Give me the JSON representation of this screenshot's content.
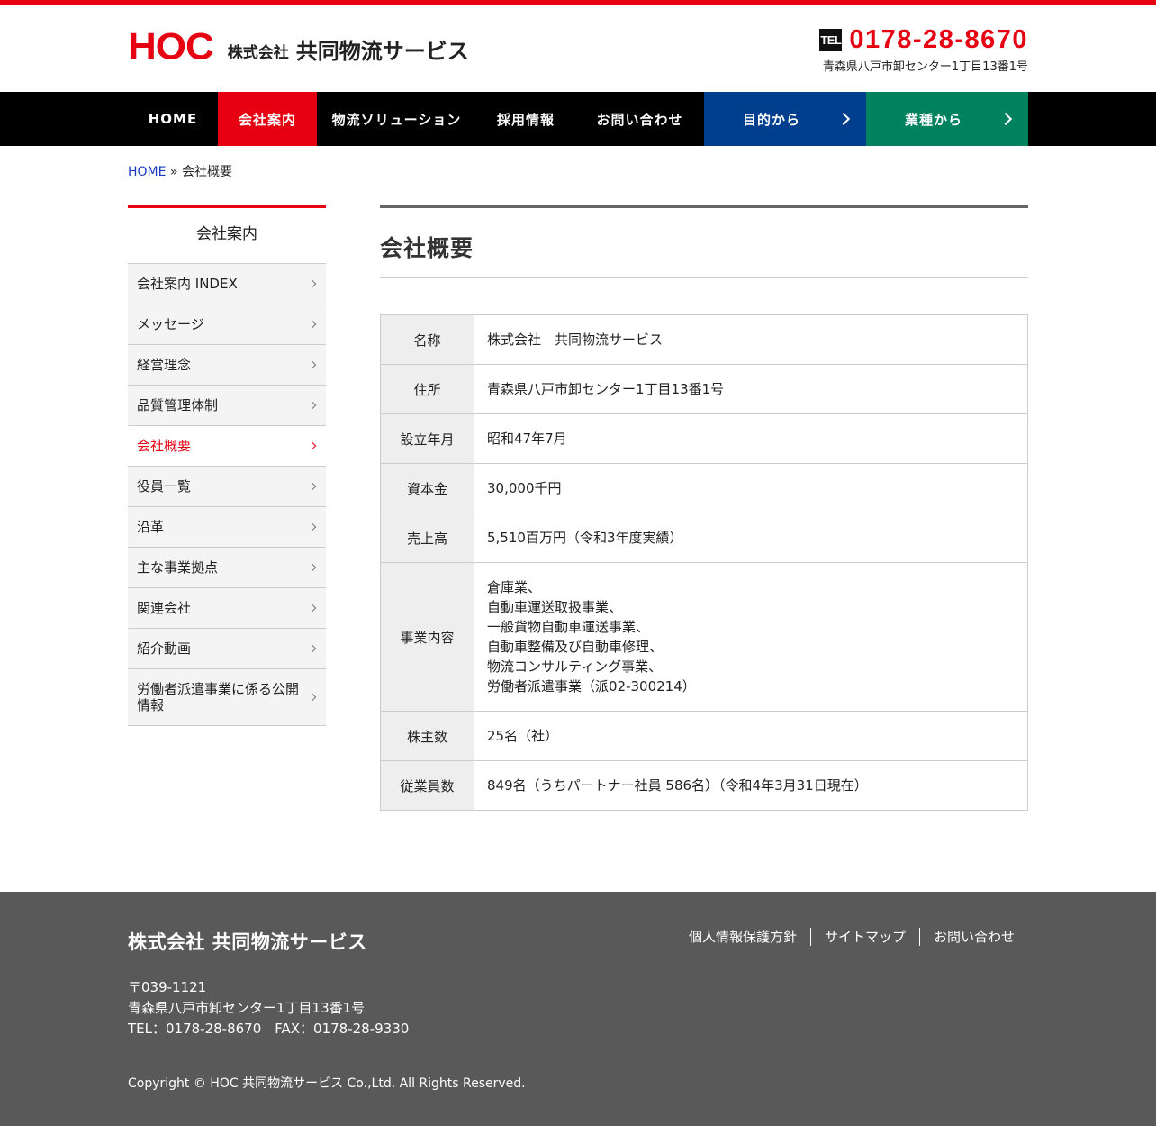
{
  "colors": {
    "accent": "#e60012",
    "nav_bg": "#000000",
    "cta_purpose": "#003f8e",
    "cta_industry": "#00825f",
    "footer_bg": "#595959"
  },
  "header": {
    "logo_mark": "HOC",
    "logo_kabushiki": "株式会社",
    "logo_name": "共同物流サービス",
    "tel_badge": "TEL",
    "tel_number": "0178-28-8670",
    "tel_address": "青森県八戸市卸センター1丁目13番1号"
  },
  "nav": {
    "items": [
      {
        "label": "HOME"
      },
      {
        "label": "会社案内"
      },
      {
        "label": "物流ソリューション"
      },
      {
        "label": "採用情報"
      },
      {
        "label": "お問い合わせ"
      }
    ],
    "cta_purpose": "目的から",
    "cta_industry": "業種から"
  },
  "breadcrumb": {
    "home": "HOME",
    "sep": " » ",
    "current": "会社概要"
  },
  "sidebar": {
    "title": "会社案内",
    "items": [
      {
        "label": "会社案内 INDEX"
      },
      {
        "label": "メッセージ"
      },
      {
        "label": "経営理念"
      },
      {
        "label": "品質管理体制"
      },
      {
        "label": "会社概要"
      },
      {
        "label": "役員一覧"
      },
      {
        "label": "沿革"
      },
      {
        "label": "主な事業拠点"
      },
      {
        "label": "関連会社"
      },
      {
        "label": "紹介動画"
      },
      {
        "label": "労働者派遣事業に係る公開情報"
      }
    ]
  },
  "main": {
    "title": "会社概要",
    "rows": [
      {
        "label": "名称",
        "value": "株式会社　共同物流サービス"
      },
      {
        "label": "住所",
        "value": "青森県八戸市卸センター1丁目13番1号"
      },
      {
        "label": "設立年月",
        "value": "昭和47年7月"
      },
      {
        "label": "資本金",
        "value": "30,000千円"
      },
      {
        "label": "売上高",
        "value": "5,510百万円（令和3年度実績）"
      },
      {
        "label": "事業内容",
        "lines": [
          "倉庫業、",
          "自動車運送取扱事業、",
          "一般貨物自動車運送事業、",
          "自動車整備及び自動車修理、",
          "物流コンサルティング事業、",
          "労働者派遣事業（派02-300214）"
        ]
      },
      {
        "label": "株主数",
        "value": "25名（社）"
      },
      {
        "label": "従業員数",
        "value": "849名（うちパートナー社員 586名）（令和4年3月31日現在）"
      }
    ]
  },
  "footer": {
    "company": "株式会社 共同物流サービス",
    "links": [
      "個人情報保護方針",
      "サイトマップ",
      "お問い合わせ"
    ],
    "postal": "〒039-1121",
    "address": "青森県八戸市卸センター1丁目13番1号",
    "tel_fax": "TEL：0178-28-8670　FAX：0178-28-9330",
    "copyright": "Copyright © HOC 共同物流サービス Co.,Ltd. All Rights Reserved."
  }
}
